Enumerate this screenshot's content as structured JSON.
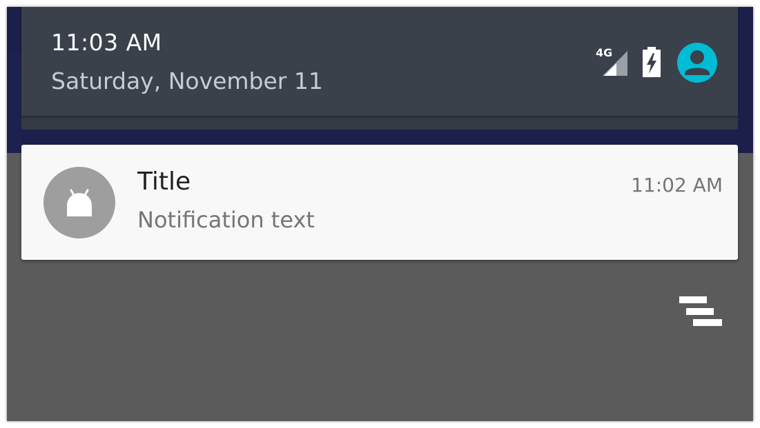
{
  "status_header": {
    "time": "11:03 AM",
    "date": "Saturday, November 11",
    "network_label": "4G",
    "icons": [
      "signal-4g-icon",
      "battery-charging-icon",
      "user-avatar-icon"
    ],
    "avatar_color": "#00bcd4"
  },
  "notification": {
    "title": "Title",
    "text": "Notification text",
    "time": "11:02 AM",
    "icon": "android-icon"
  },
  "actions": {
    "dismiss_all_icon": "clear-all-icon"
  }
}
